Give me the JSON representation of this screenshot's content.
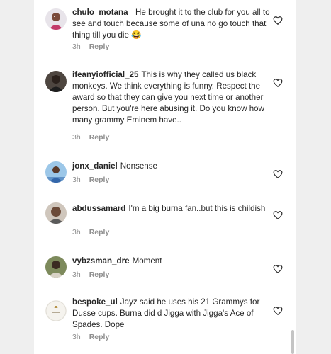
{
  "comments": [
    {
      "username": "chulo_motana_",
      "text": "He brought it to the club for you all to see and touch because some of una no go touch that thing till you die 😂",
      "time": "3h",
      "reply": "Reply",
      "avatar_icon": "avatar-photo-icon"
    },
    {
      "username": "ifeanyiofficial_25",
      "text": "This is why they called us black monkeys. We think everything is funny. Respect the award so that they can give you next time or another person. But you're here abusing it. Do you know how many grammy Eminem have..",
      "time": "3h",
      "reply": "Reply",
      "avatar_icon": "avatar-photo-icon"
    },
    {
      "username": "jonx_daniel",
      "text": "Nonsense",
      "time": "3h",
      "reply": "Reply",
      "avatar_icon": "avatar-photo-icon"
    },
    {
      "username": "abdussamard",
      "text": "I'm a big burna fan..but this is childish",
      "time": "3h",
      "reply": "Reply",
      "avatar_icon": "avatar-photo-icon"
    },
    {
      "username": "vybzsman_dre",
      "text": "Moment",
      "time": "3h",
      "reply": "Reply",
      "avatar_icon": "avatar-photo-icon"
    },
    {
      "username": "bespoke_ul",
      "text": "Jayz said he uses his 21 Grammys for Dusse cups. Burna did d Jigga with  Jigga's Ace of Spades. Dope",
      "time": "3h",
      "reply": "Reply",
      "avatar_icon": "avatar-logo-icon"
    }
  ],
  "colors": {
    "text": "#262626",
    "meta": "#8e8e8e",
    "background": "#ffffff",
    "page": "#efefef"
  },
  "icons": {
    "like": "heart-outline-icon"
  }
}
